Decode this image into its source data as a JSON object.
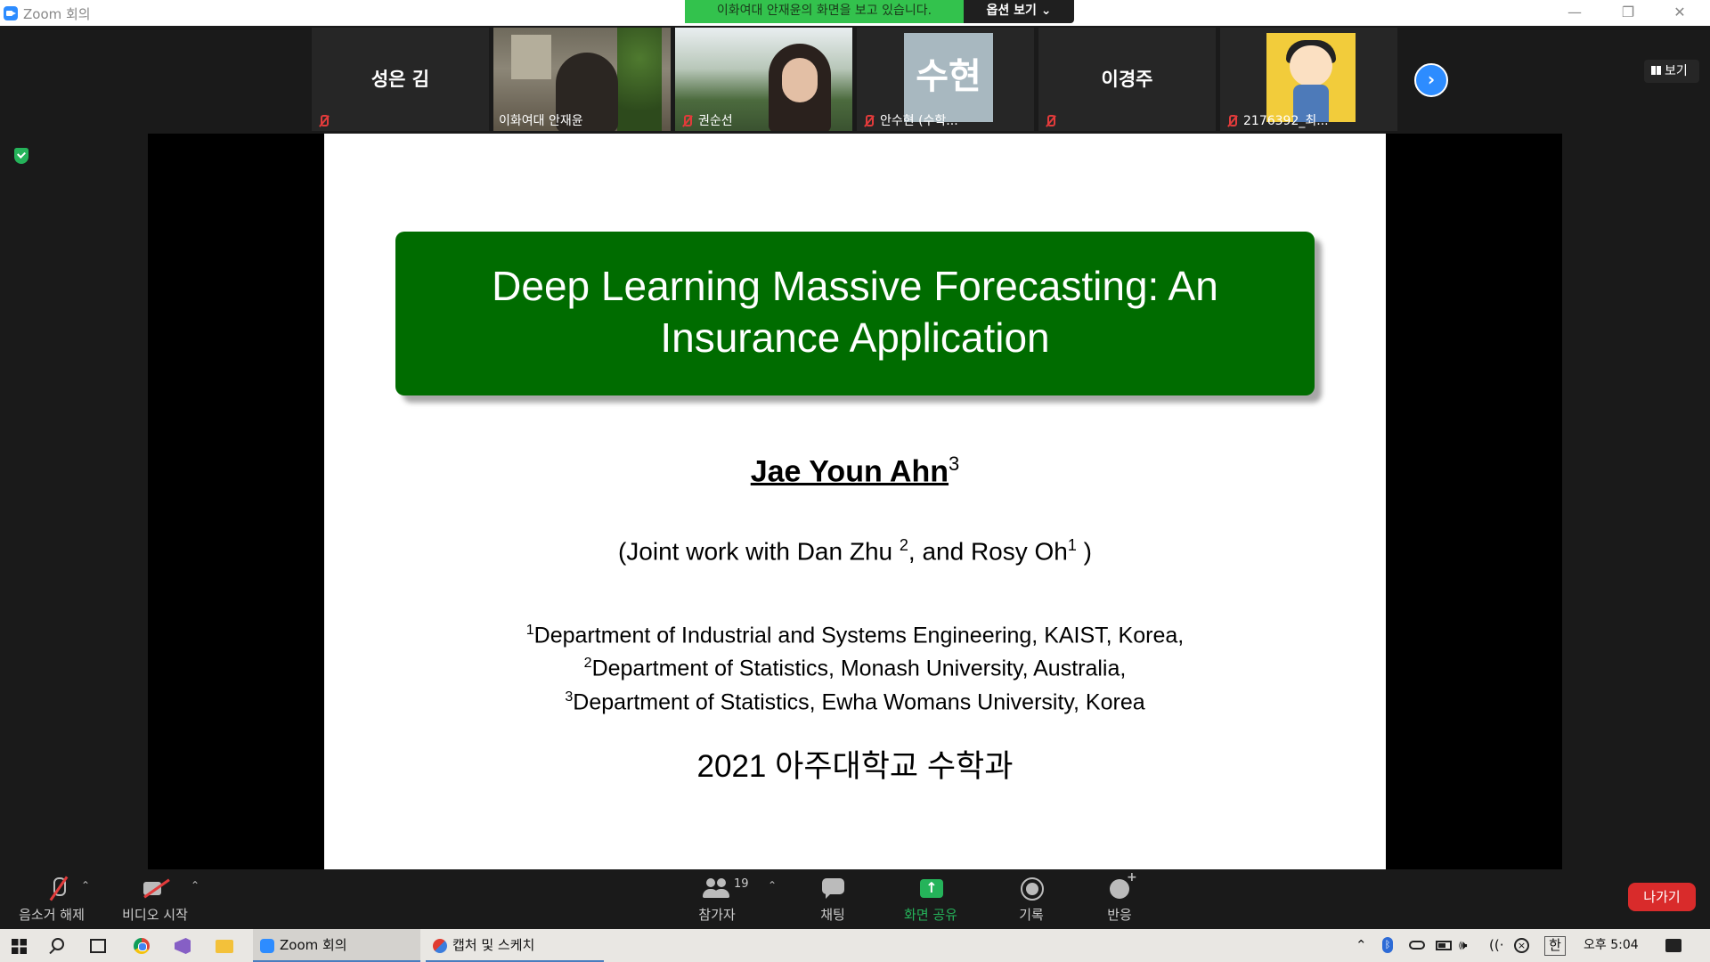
{
  "window": {
    "title": "Zoom 회의",
    "minimize": "—",
    "maximize": "❐",
    "close": "✕"
  },
  "share_banner": {
    "text": "이화여대 안재윤의 화면을 보고 있습니다.",
    "options_label": "옵션 보기 ⌄"
  },
  "gallery": {
    "participants": [
      {
        "display": "성은 김",
        "label": ""
      },
      {
        "display": "",
        "label": "이화여대 안재윤"
      },
      {
        "display": "",
        "label": "권순선"
      },
      {
        "display": "수현",
        "label": "안수현 (수학..."
      },
      {
        "display": "이경주",
        "label": ""
      },
      {
        "display": "",
        "label": "2176392_최..."
      }
    ],
    "next_arrow": "›",
    "view_label": "보기"
  },
  "slide": {
    "title_line1": "Deep Learning Massive Forecasting: An",
    "title_line2": "Insurance Application",
    "author": "Jae Youn Ahn",
    "author_sup": "3",
    "joint_prefix": "(Joint work with Dan Zhu ",
    "joint_sup1": "2",
    "joint_middle": ", and Rosy Oh",
    "joint_sup2": "1",
    "joint_suffix": " )",
    "affiliations": [
      {
        "sup": "1",
        "text": "Department of Industrial and Systems Engineering, KAIST, Korea,"
      },
      {
        "sup": "2",
        "text": "Department of Statistics, Monash University, Australia,"
      },
      {
        "sup": "3",
        "text": "Department of Statistics, Ewha Womans University, Korea"
      }
    ],
    "footer": "2021 아주대학교 수학과"
  },
  "toolbar": {
    "unmute": "음소거 해제",
    "start_video": "비디오 시작",
    "participants": "참가자",
    "participant_count": "19",
    "chat": "채팅",
    "share_screen": "화면 공유",
    "record": "기록",
    "reactions": "반응",
    "leave": "나가기",
    "caret": "⌃"
  },
  "taskbar": {
    "apps": [
      {
        "label": "Zoom 회의"
      },
      {
        "label": "캡처 및 스케치"
      }
    ],
    "tray_up": "⌃",
    "bluetooth": "ᛒ",
    "volume": "🕪",
    "wifi": "((·",
    "ime": "한",
    "time": "오후 5:04"
  }
}
